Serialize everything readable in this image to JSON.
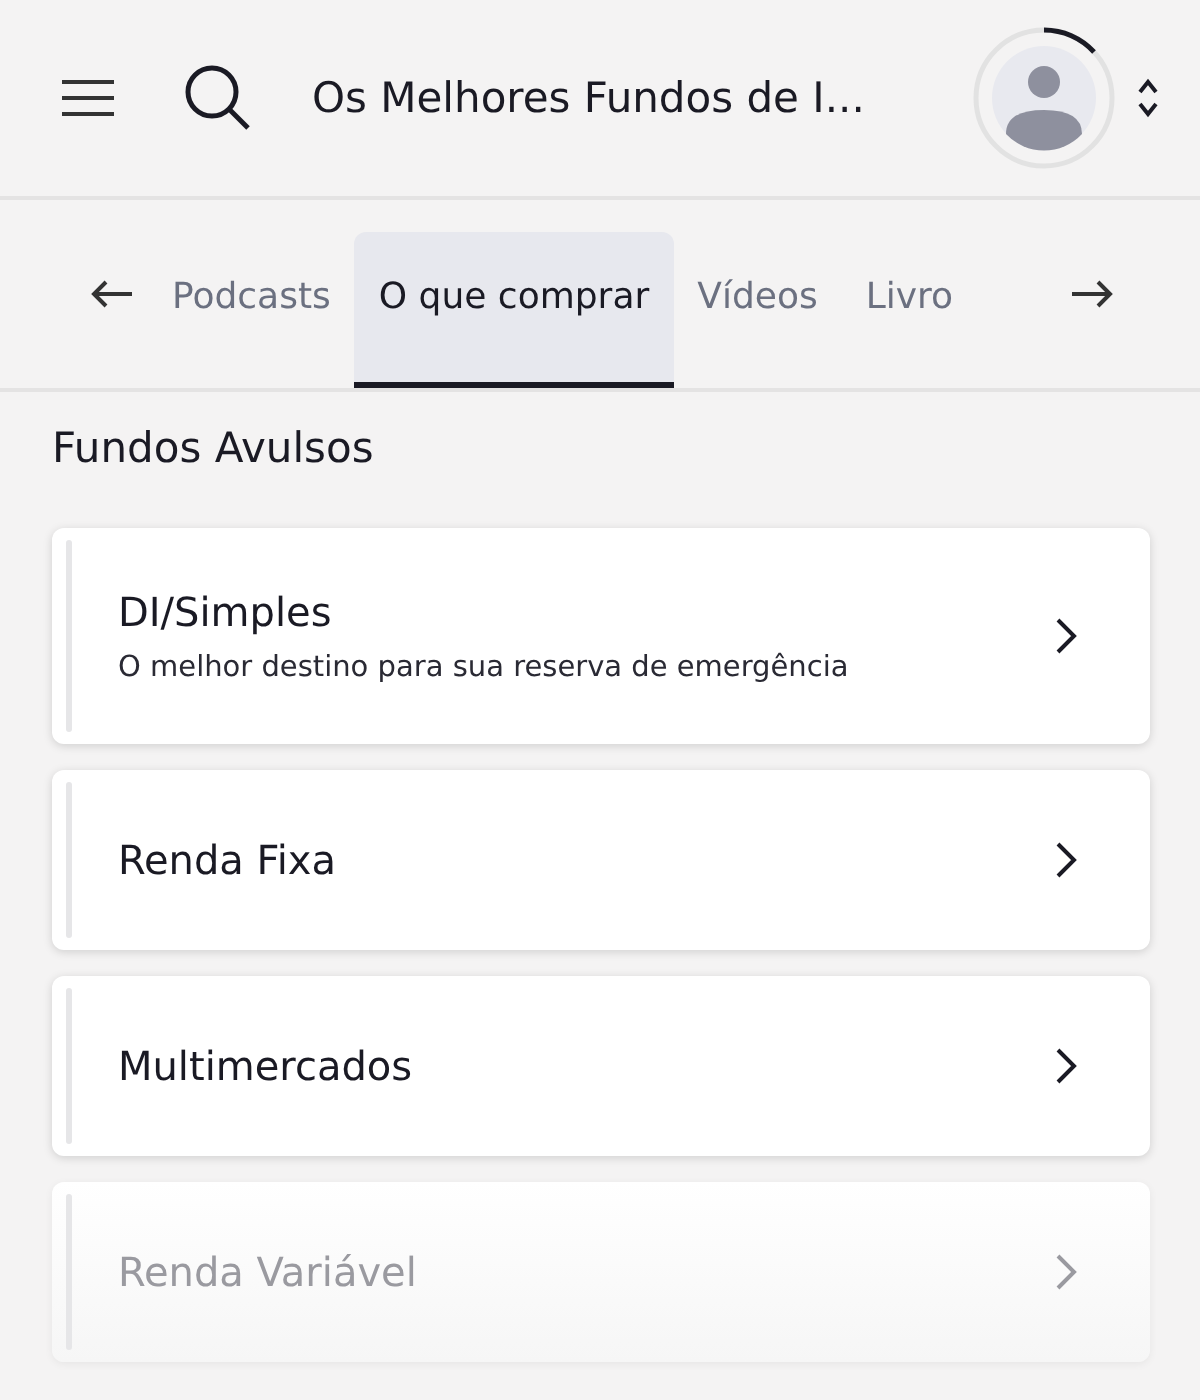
{
  "header": {
    "title": "Os Melhores Fundos de I..."
  },
  "tabs": [
    {
      "label": "Podcasts",
      "selected": false
    },
    {
      "label": "O que comprar",
      "selected": true
    },
    {
      "label": "Vídeos",
      "selected": false
    },
    {
      "label": "Livro",
      "selected": false
    }
  ],
  "section": {
    "title": "Fundos Avulsos"
  },
  "cards": [
    {
      "title": "DI/Simples",
      "subtitle": "O melhor destino para sua reserva de emergência",
      "dimmed": false
    },
    {
      "title": "Renda Fixa",
      "dimmed": false
    },
    {
      "title": "Multimercados",
      "dimmed": false
    },
    {
      "title": "Renda Variável",
      "dimmed": true
    }
  ]
}
